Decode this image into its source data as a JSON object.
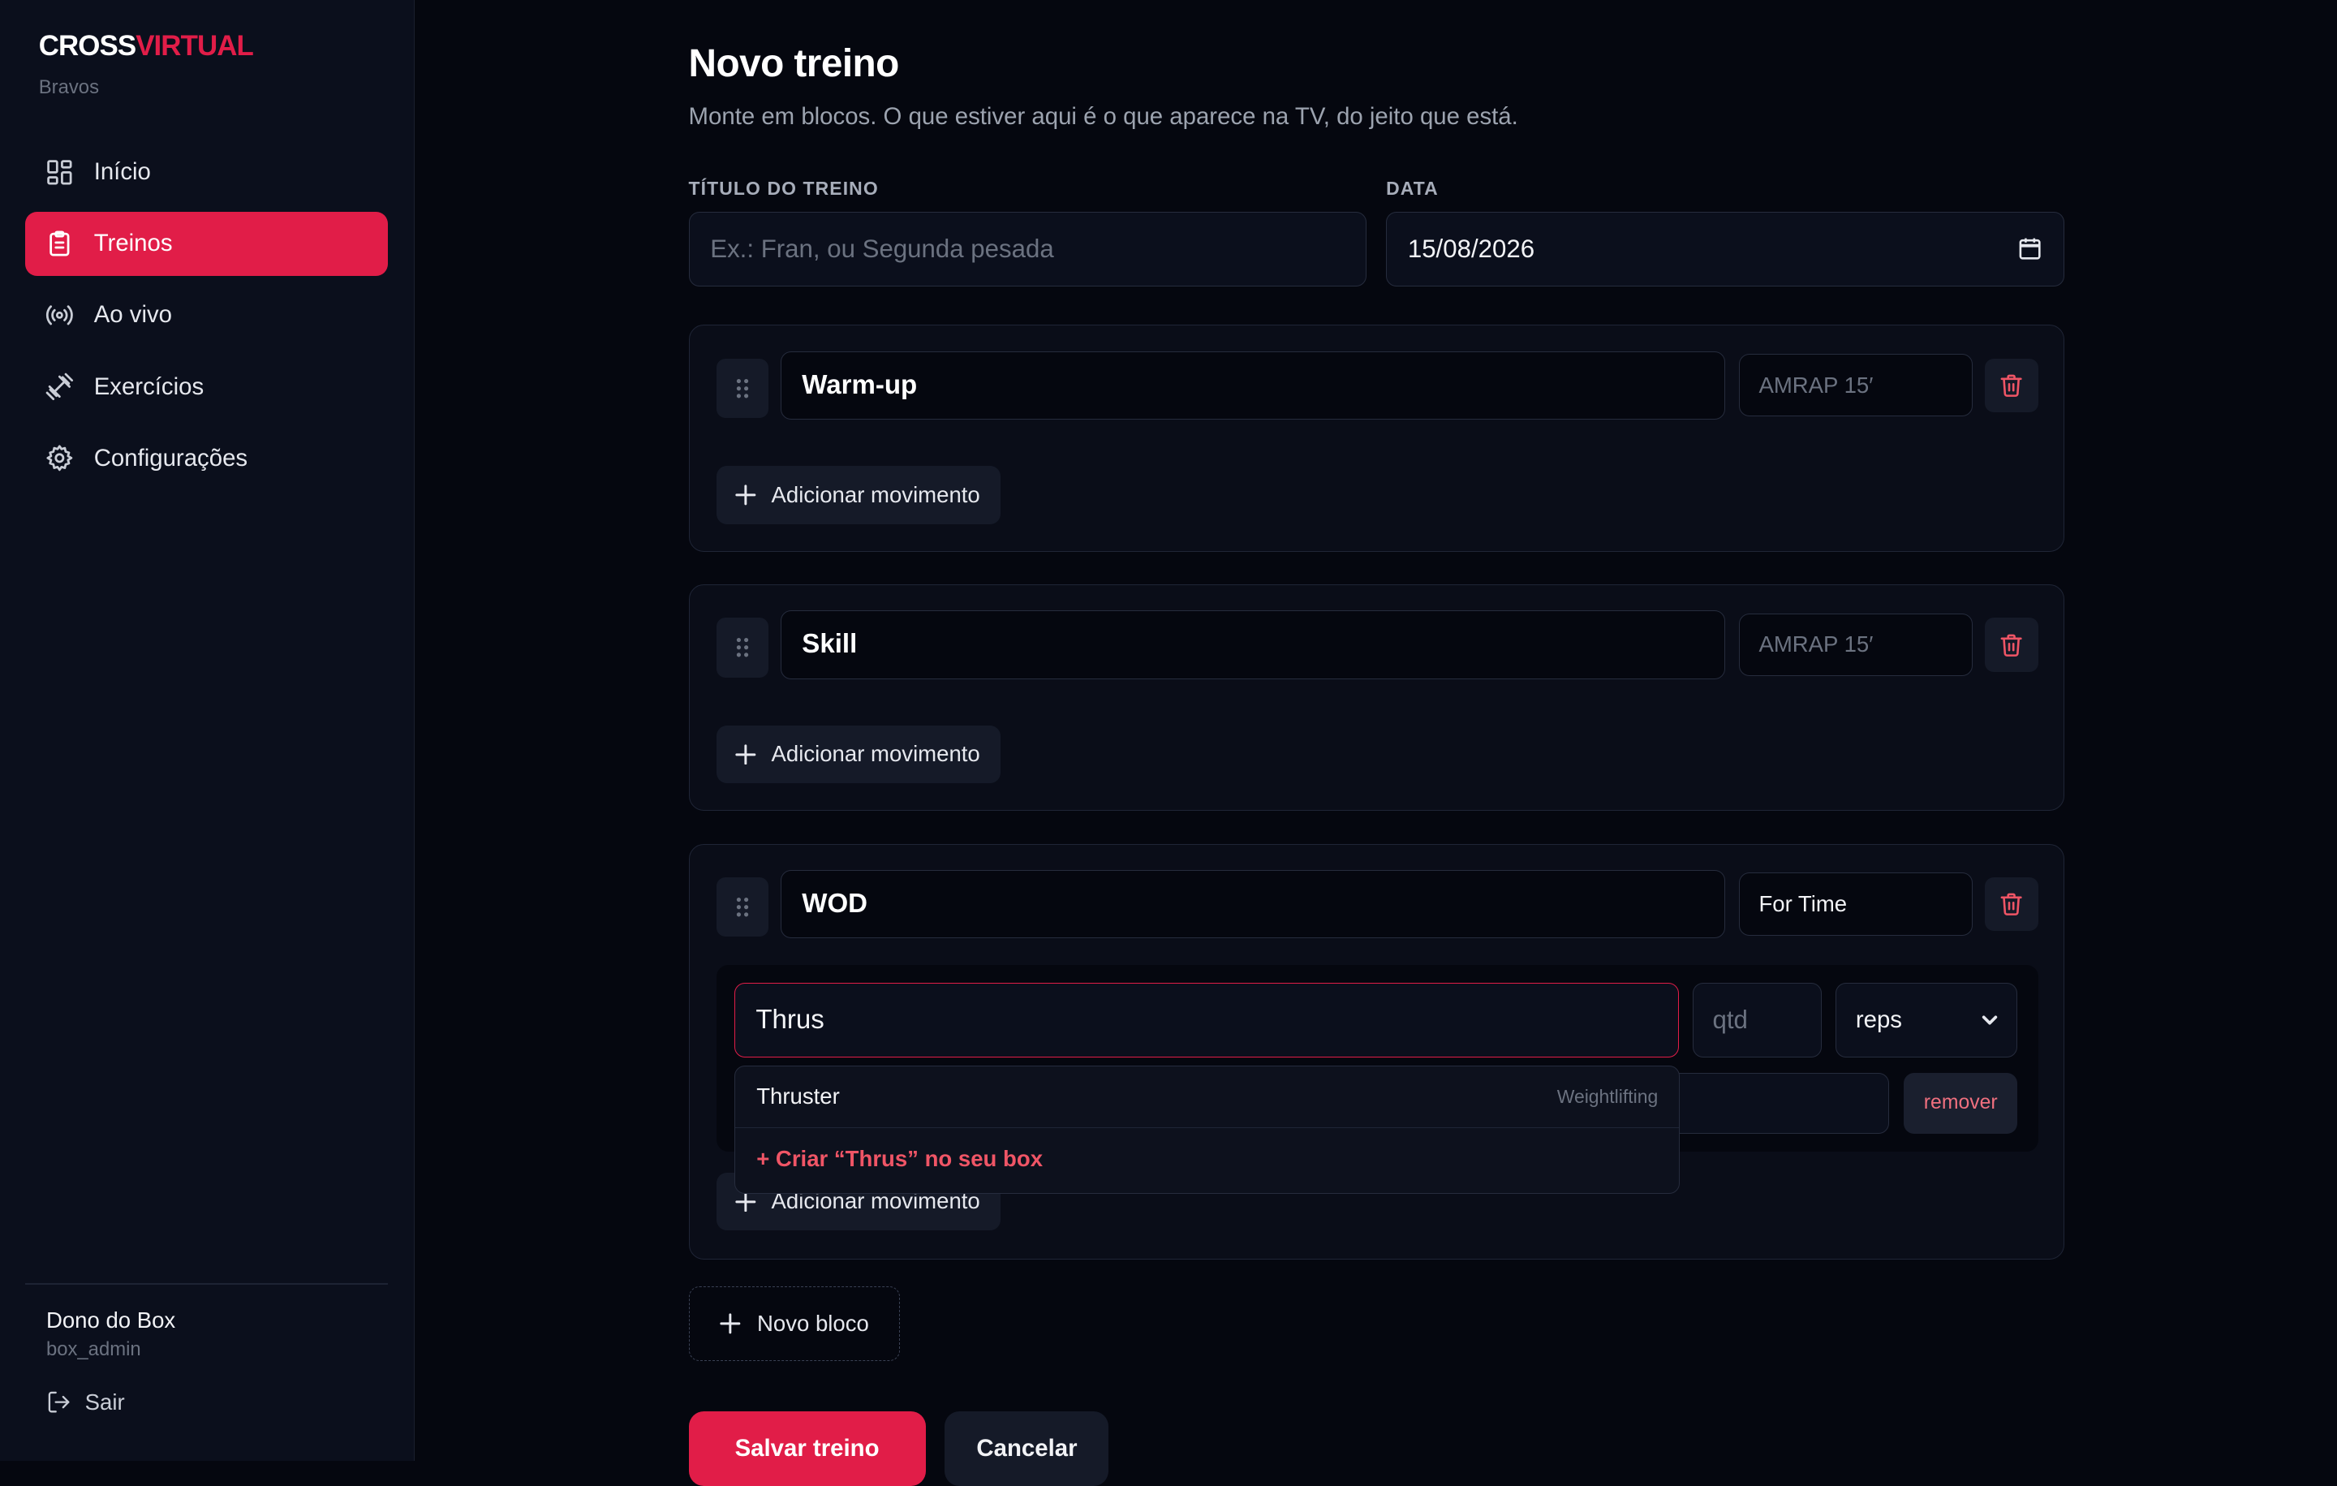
{
  "brand": {
    "part1": "CROSS",
    "part2": "VIRTUAL",
    "box": "Bravos",
    "accent": "#e11d48"
  },
  "nav": [
    {
      "label": "Início",
      "icon": "dashboard-icon",
      "active": false
    },
    {
      "label": "Treinos",
      "icon": "clipboard-list-icon",
      "active": true
    },
    {
      "label": "Ao vivo",
      "icon": "broadcast-icon",
      "active": false
    },
    {
      "label": "Exercícios",
      "icon": "dumbbell-icon",
      "active": false
    },
    {
      "label": "Configurações",
      "icon": "gear-icon",
      "active": false
    }
  ],
  "user": {
    "name": "Dono do Box",
    "handle": "box_admin",
    "logout": "Sair"
  },
  "page": {
    "title": "Novo treino",
    "subtitle": "Monte em blocos. O que estiver aqui é o que aparece na TV, do jeito que está."
  },
  "form": {
    "title_label": "TÍTULO DO TREINO",
    "title_placeholder": "Ex.: Fran, ou Segunda pesada",
    "title_value": "",
    "date_label": "DATA",
    "date_value": "15/08/2026"
  },
  "blocks": [
    {
      "name": "Warm-up",
      "format_value": "",
      "format_placeholder": "AMRAP 15′",
      "add_label": "Adicionar movimento"
    },
    {
      "name": "Skill",
      "format_value": "",
      "format_placeholder": "AMRAP 15′",
      "add_label": "Adicionar movimento"
    },
    {
      "name": "WOD",
      "format_value": "For Time",
      "format_placeholder": "AMRAP 15′",
      "add_label": "Adicionar movimento",
      "movement": {
        "name_value": "Thrus",
        "qty_placeholder": "qtd",
        "qty_value": "",
        "unit": "reps",
        "remove_label": "remover"
      }
    }
  ],
  "autocomplete": {
    "suggestion": {
      "name": "Thruster",
      "category": "Weightlifting"
    },
    "create_label": "+ Criar “Thrus” no seu box"
  },
  "actions": {
    "new_block": "Novo bloco",
    "save": "Salvar treino",
    "cancel": "Cancelar"
  }
}
